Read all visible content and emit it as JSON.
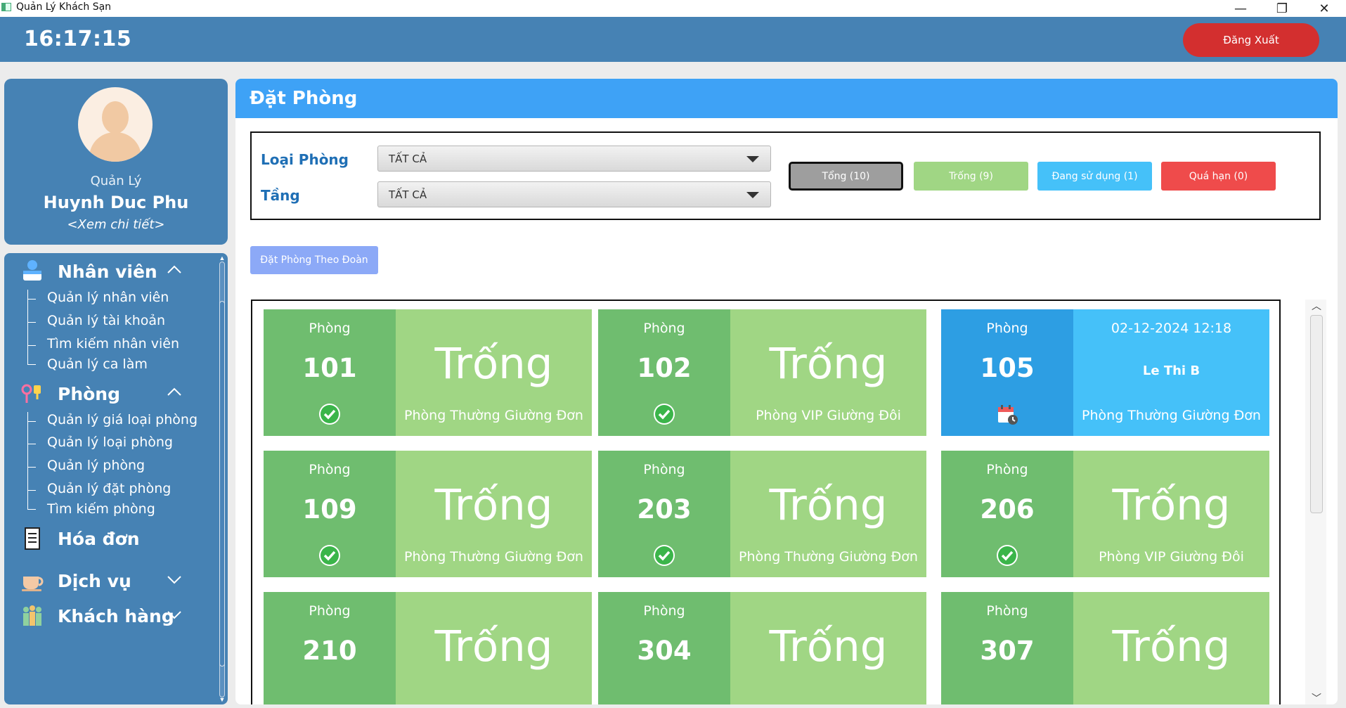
{
  "window": {
    "title": "Quản Lý Khách Sạn",
    "minimize": "—",
    "maximize": "❐",
    "close": "✕"
  },
  "header": {
    "clock": "16:17:15",
    "logout_label": "Đăng Xuất"
  },
  "profile": {
    "role": "Quản Lý",
    "name": "Huynh Duc Phu",
    "detail_link": "<Xem chi tiết>"
  },
  "menu": {
    "staff": {
      "label": "Nhân viên",
      "items": [
        "Quản lý nhân viên",
        "Quản lý tài khoản",
        "Tìm kiếm nhân viên",
        "Quản lý ca làm"
      ]
    },
    "room": {
      "label": "Phòng",
      "items": [
        "Quản lý giá loại phòng",
        "Quản lý loại phòng",
        "Quản lý phòng",
        "Quản lý đặt phòng",
        "Tìm kiếm phòng"
      ]
    },
    "invoice": {
      "label": "Hóa đơn"
    },
    "service": {
      "label": "Dịch vụ"
    },
    "customer": {
      "label": "Khách hàng"
    }
  },
  "main": {
    "title": "Đặt Phòng",
    "filter": {
      "room_type_label": "Loại Phòng",
      "room_type_value": "TẤT CẢ",
      "floor_label": "Tầng",
      "floor_value": "TẤT CẢ"
    },
    "status_buttons": {
      "total": "Tổng (10)",
      "free": "Trống (9)",
      "in_use": "Đang sử dụng (1)",
      "overdue": "Quá hạn  (0)"
    },
    "group_booking_label": "Đặt Phòng Theo Đoàn"
  },
  "colors": {
    "header": "#4682b4",
    "accent": "#3ea2f6",
    "free_dark": "#6fbd6f",
    "free_light": "#a0d684",
    "busy_dark": "#2d9ee3",
    "busy_light": "#45c1f9",
    "logout": "#d32f2f"
  },
  "rooms": [
    {
      "label": "Phòng",
      "number": "101",
      "status": "Trống",
      "type": "Phòng Thường Giường Đơn",
      "icon": "check-icon"
    },
    {
      "label": "Phòng",
      "number": "102",
      "status": "Trống",
      "type": "Phòng VIP Giường Đôi",
      "icon": "check-icon"
    },
    {
      "label": "Phòng",
      "number": "105",
      "date": "02-12-2024 12:18",
      "guest": "Le Thi B",
      "type": "Phòng Thường Giường Đơn",
      "icon": "calendar-clock-icon"
    },
    {
      "label": "Phòng",
      "number": "109",
      "status": "Trống",
      "type": "Phòng Thường Giường Đơn",
      "icon": "check-icon"
    },
    {
      "label": "Phòng",
      "number": "203",
      "status": "Trống",
      "type": "Phòng Thường Giường Đơn",
      "icon": "check-icon"
    },
    {
      "label": "Phòng",
      "number": "206",
      "status": "Trống",
      "type": "Phòng VIP Giường Đôi",
      "icon": "check-icon"
    },
    {
      "label": "Phòng",
      "number": "210",
      "status": "Trống"
    },
    {
      "label": "Phòng",
      "number": "304",
      "status": "Trống"
    },
    {
      "label": "Phòng",
      "number": "307",
      "status": "Trống"
    }
  ]
}
